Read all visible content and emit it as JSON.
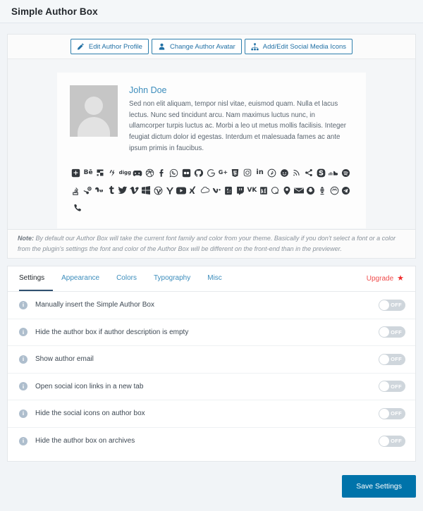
{
  "header": {
    "title": "Simple Author Box"
  },
  "toolbar": {
    "buttons": [
      {
        "label": "Edit Author Profile",
        "icon": "pencil-icon"
      },
      {
        "label": "Change Author Avatar",
        "icon": "user-avatar-icon"
      },
      {
        "label": "Add/Edit Social Media Icons",
        "icon": "sitemap-icon"
      }
    ]
  },
  "preview": {
    "author_name": "John Doe",
    "author_description": "Sed non elit aliquam, tempor nisl vitae, euismod quam. Nulla et lacus lectus. Nunc sed tincidunt arcu. Nam maximus luctus nunc, in ullamcorper turpis luctus ac. Morbi a leo ut metus mollis facilisis. Integer feugiat dictum dolor id egestas. Interdum et malesuada fames ac ante ipsum primis in faucibus.",
    "avatar_alt": "placeholder-avatar",
    "social_rows": [
      [
        "500px",
        "behance",
        "bitbucket",
        "blogger",
        "digg",
        "discord",
        "dribbble",
        "facebook",
        "messenger",
        "flickr",
        "github",
        "google",
        "google-plus",
        "html5",
        "instagram",
        "linkedin",
        "pinterest",
        "reddit",
        "rss",
        "share",
        "skype",
        "soundcloud",
        "spotify"
      ],
      [
        "stack-overflow",
        "steam",
        "stumbleupon",
        "tumblr",
        "twitter",
        "vimeo",
        "windows",
        "wordpress",
        "yahoo",
        "youtube",
        "xing",
        "icloud",
        "vine",
        "yelp",
        "twitch",
        "vk",
        "medium",
        "quora",
        "periscope",
        "envelope",
        "snapchat",
        "dribbble-ball",
        "mastodon",
        "telegram"
      ],
      [
        "phone"
      ]
    ]
  },
  "note": {
    "prefix": "Note:",
    "text": " By default our Author Box will take the current font family and color from your theme. Basically if you don't select a font or a color from the plugin's settings the font and color of the Author Box will be different on the front-end than in the previewer."
  },
  "tabs": {
    "items": [
      {
        "label": "Settings",
        "active": true
      },
      {
        "label": "Appearance",
        "active": false
      },
      {
        "label": "Colors",
        "active": false
      },
      {
        "label": "Typography",
        "active": false
      },
      {
        "label": "Misc",
        "active": false
      }
    ],
    "upgrade_label": "Upgrade",
    "upgrade_icon": "star-icon"
  },
  "settings": {
    "rows": [
      {
        "label": "Manually insert the Simple Author Box",
        "toggle": "OFF"
      },
      {
        "label": "Hide the author box if author description is empty",
        "toggle": "OFF"
      },
      {
        "label": "Show author email",
        "toggle": "OFF"
      },
      {
        "label": "Open social icon links in a new tab",
        "toggle": "OFF"
      },
      {
        "label": "Hide the social icons on author box",
        "toggle": "OFF"
      },
      {
        "label": "Hide the author box on archives",
        "toggle": "OFF"
      }
    ]
  },
  "footer": {
    "save_label": "Save Settings"
  },
  "colors": {
    "accent": "#0073aa",
    "link": "#3c8dbc",
    "upgrade": "#f04c4c",
    "page_bg": "#f1f4f7",
    "toggle_off": "#cfd6dc"
  }
}
